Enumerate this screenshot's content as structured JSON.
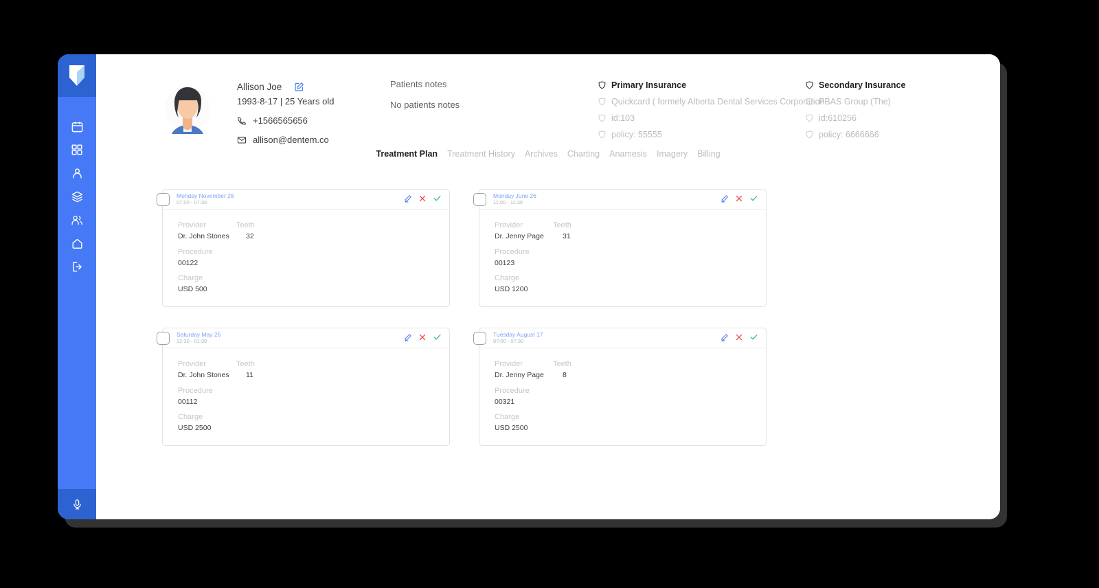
{
  "app": {
    "logo_icon": "tooth-logo-icon",
    "accent_color": "#4579f5",
    "accent_dark": "#2d62d1"
  },
  "sidebar": {
    "items": [
      {
        "icon": "calendar-icon",
        "name": "calendar"
      },
      {
        "icon": "grid-icon",
        "name": "dashboard"
      },
      {
        "icon": "person-icon",
        "name": "patients"
      },
      {
        "icon": "layers-icon",
        "name": "records"
      },
      {
        "icon": "group-icon",
        "name": "staff"
      },
      {
        "icon": "home-icon",
        "name": "home"
      },
      {
        "icon": "logout-icon",
        "name": "logout"
      }
    ],
    "footer": {
      "icon": "microphone-icon",
      "name": "voice"
    }
  },
  "patient": {
    "avatar_icon": "patient-avatar",
    "name": "Allison Joe",
    "edit_icon": "edit-icon",
    "meta": "1993-8-17 | 25 Years old",
    "phone_icon": "phone-icon",
    "phone": "+1566565656",
    "email_icon": "email-icon",
    "email": "allison@dentem.co"
  },
  "notes": {
    "title": "Patients notes",
    "body": "No patients notes"
  },
  "insurance": {
    "primary": {
      "title": "Primary Insurance",
      "provider": "Quickcard ( formely Alberta Dental Services Corporation",
      "id": "id:103",
      "policy": "policy: 55555"
    },
    "secondary": {
      "title": "Secondary Insurance",
      "provider": "PBAS Group (The)",
      "id": "id:610256",
      "policy": "policy: 6666666"
    }
  },
  "tabs": [
    {
      "label": "Treatment Plan",
      "active": true
    },
    {
      "label": "Treatment History",
      "active": false
    },
    {
      "label": "Archives",
      "active": false
    },
    {
      "label": "Charting",
      "active": false
    },
    {
      "label": "Anamesis",
      "active": false
    },
    {
      "label": "Imagery",
      "active": false
    },
    {
      "label": "Billing",
      "active": false
    }
  ],
  "card_labels": {
    "provider": "Provider",
    "teeth": "Teeth",
    "procedure": "Procedure",
    "charge": "Charge"
  },
  "card_action_icons": {
    "edit": "edit-icon",
    "delete": "close-x-icon",
    "confirm": "check-icon"
  },
  "treatments": [
    {
      "date": "Monday November 26",
      "time": "07:00 - 07:30",
      "provider": "Dr. John Stones",
      "teeth": "32",
      "procedure": "00122",
      "charge": "USD 500"
    },
    {
      "date": "Monday June 26",
      "time": "11:00 - 11:30",
      "provider": "Dr. Jenny Page",
      "teeth": "31",
      "procedure": "00123",
      "charge": "USD 1200"
    },
    {
      "date": "Saturday May 26",
      "time": "12:30 - 01:30",
      "provider": "Dr. John Stones",
      "teeth": "11",
      "procedure": "00112",
      "charge": "USD 2500"
    },
    {
      "date": "Tuesday August 17",
      "time": "07:00 - 07:30",
      "provider": "Dr. Jenny Page",
      "teeth": "8",
      "procedure": "00321",
      "charge": "USD 2500"
    }
  ]
}
